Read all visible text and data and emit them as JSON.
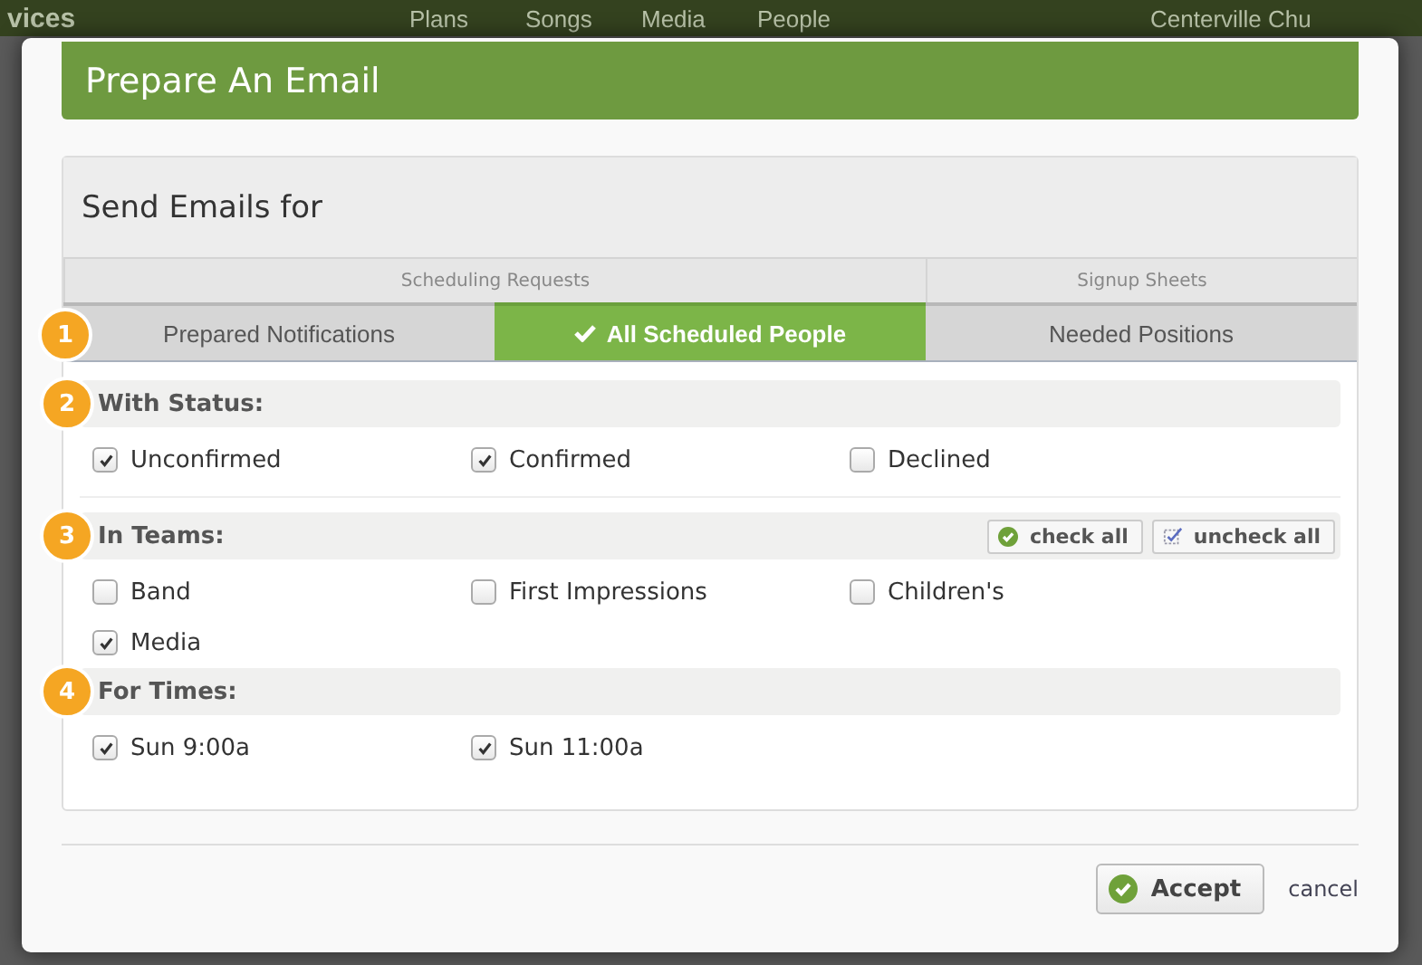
{
  "background_nav": {
    "brand": "vices",
    "items": [
      "Plans",
      "Songs",
      "Media",
      "People"
    ],
    "account": "Centerville Chu"
  },
  "dialog": {
    "title": "Prepare An Email",
    "heading": "Send Emails for",
    "tabs_step": "1",
    "tab_groups": [
      {
        "label": "Scheduling Requests",
        "tabs": [
          {
            "label": "Prepared Notifications",
            "selected": false
          },
          {
            "label": "All Scheduled People",
            "selected": true
          }
        ]
      },
      {
        "label": "Signup Sheets",
        "tabs": [
          {
            "label": "Needed Positions",
            "selected": false
          }
        ]
      }
    ],
    "sections": [
      {
        "step": "2",
        "title": "With Status:",
        "options": [
          {
            "label": "Unconfirmed",
            "checked": true
          },
          {
            "label": "Confirmed",
            "checked": true
          },
          {
            "label": "Declined",
            "checked": false
          }
        ]
      },
      {
        "step": "3",
        "title": "In Teams:",
        "check_all": "check all",
        "uncheck_all": "uncheck all",
        "options": [
          {
            "label": "Band",
            "checked": false
          },
          {
            "label": "First Impressions",
            "checked": false
          },
          {
            "label": "Children's",
            "checked": false
          },
          {
            "label": "Media",
            "checked": true
          }
        ]
      },
      {
        "step": "4",
        "title": "For Times:",
        "options": [
          {
            "label": "Sun 9:00a",
            "checked": true
          },
          {
            "label": "Sun 11:00a",
            "checked": true
          }
        ]
      }
    ],
    "accept": "Accept",
    "cancel": "cancel"
  }
}
